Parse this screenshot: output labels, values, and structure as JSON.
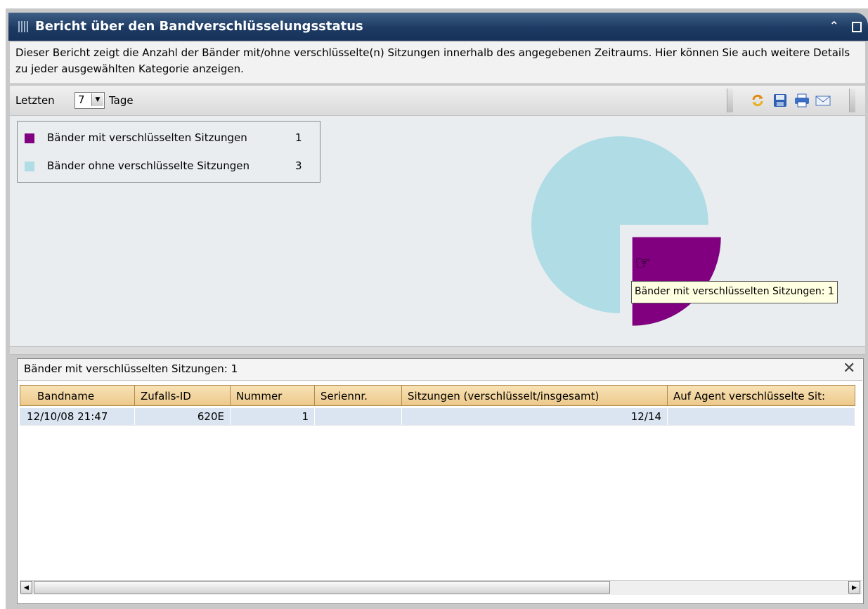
{
  "window": {
    "title": "Bericht über den Bandverschlüsselungsstatus",
    "collapse_icon": "double-chevron-up-icon",
    "maximize_icon": "maximize-icon"
  },
  "description": "Dieser Bericht zeigt die Anzahl der Bänder mit/ohne verschlüsselte(n) Sitzungen innerhalb des angegebenen Zeitraums. Hier können Sie auch weitere Details zu jeder ausgewählten Kategorie anzeigen.",
  "toolbar": {
    "prefix_label": "Letzten",
    "days_value": "7",
    "suffix_label": "Tage",
    "icons": [
      "refresh-icon",
      "save-icon",
      "print-icon",
      "email-icon"
    ]
  },
  "chart_data": {
    "type": "pie",
    "categories": [
      "Bänder mit verschlüsselten Sitzungen",
      "Bänder ohne verschlüsselte Sitzungen"
    ],
    "values": [
      1,
      3
    ],
    "colors": [
      "#800080",
      "#b0dde5"
    ],
    "legend_placement": "top-left",
    "exploded_slice": "Bänder mit verschlüsselten Sitzungen"
  },
  "legend": [
    {
      "label": "Bänder mit verschlüsselten Sitzungen",
      "count": "1",
      "color": "#800080"
    },
    {
      "label": "Bänder ohne verschlüsselte Sitzungen",
      "count": "3",
      "color": "#b0dde5"
    }
  ],
  "tooltip": "Bänder mit verschlüsselten Sitzungen: 1",
  "detail": {
    "title": "Bänder mit verschlüsselten Sitzungen: 1",
    "columns": [
      "Bandname",
      "Zufalls-ID",
      "Nummer",
      "Seriennr.",
      "Sitzungen (verschlüsselt/insgesamt)",
      "Auf Agent verschlüsselte Sit:"
    ],
    "rows": [
      [
        "12/10/08 21:47",
        "620E",
        "1",
        "",
        "12/14",
        ""
      ]
    ]
  }
}
